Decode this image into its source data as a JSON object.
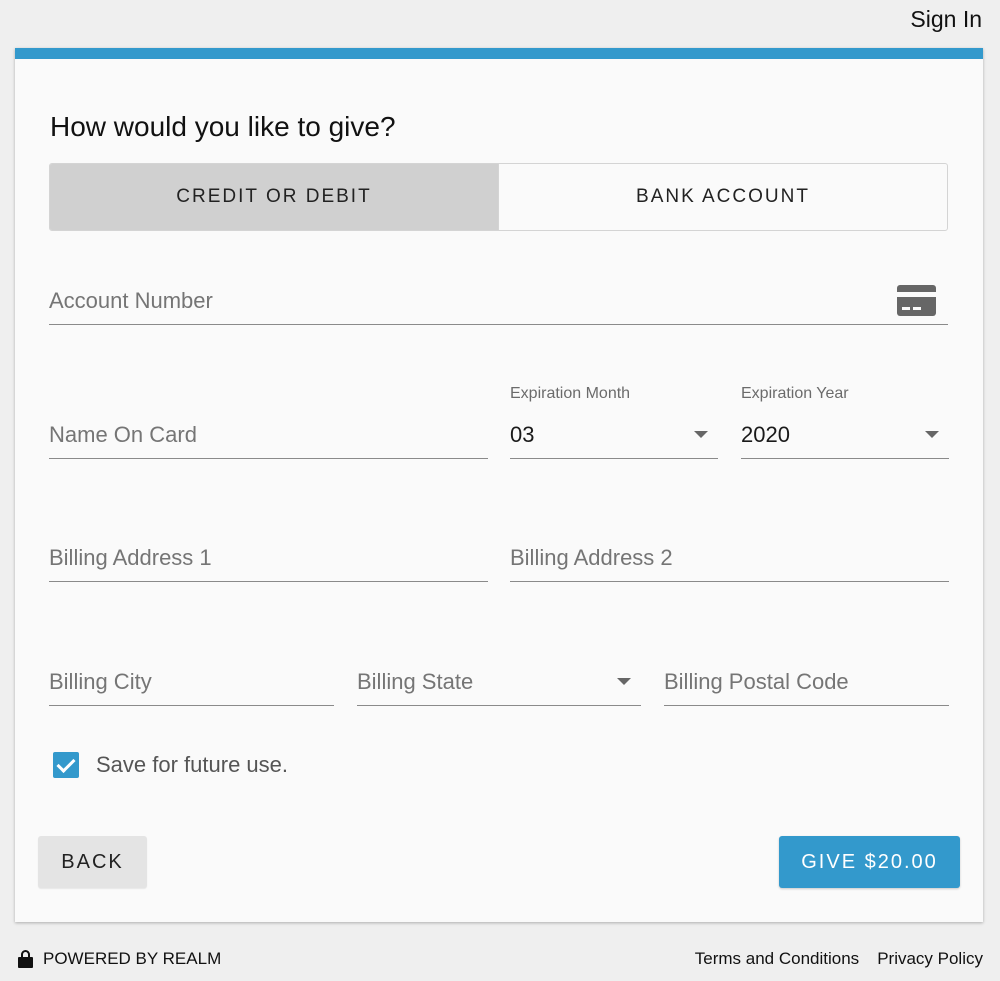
{
  "header": {
    "sign_in": "Sign In"
  },
  "form": {
    "heading": "How would you like to give?",
    "payment_tabs": [
      {
        "label": "CREDIT OR DEBIT",
        "active": true
      },
      {
        "label": "BANK ACCOUNT",
        "active": false
      }
    ],
    "account_number": {
      "placeholder": "Account Number",
      "icon": "credit-card-icon"
    },
    "name_on_card": {
      "placeholder": "Name On Card"
    },
    "expiration_month": {
      "label": "Expiration Month",
      "value": "03"
    },
    "expiration_year": {
      "label": "Expiration Year",
      "value": "2020"
    },
    "billing_address_1": {
      "placeholder": "Billing Address 1"
    },
    "billing_address_2": {
      "placeholder": "Billing Address 2"
    },
    "billing_city": {
      "placeholder": "Billing City"
    },
    "billing_state": {
      "placeholder": "Billing State"
    },
    "billing_postal_code": {
      "placeholder": "Billing Postal Code"
    },
    "save_for_future": {
      "label": "Save for future use.",
      "checked": true
    },
    "back_label": "BACK",
    "give_label": "GIVE $20.00"
  },
  "footer": {
    "powered_by": "POWERED BY REALM",
    "terms": "Terms and Conditions",
    "privacy": "Privacy Policy"
  },
  "colors": {
    "accent": "#3399cc",
    "active_tab": "#d0d0d0"
  }
}
